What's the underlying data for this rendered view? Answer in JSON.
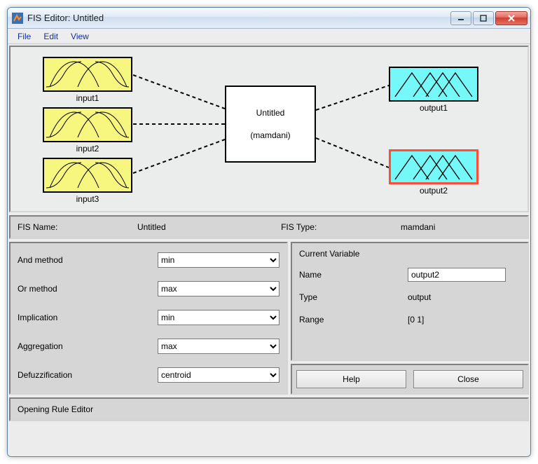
{
  "window": {
    "title": "FIS Editor: Untitled"
  },
  "menu": {
    "file": "File",
    "edit": "Edit",
    "view": "View"
  },
  "canvas": {
    "inputs": [
      "input1",
      "input2",
      "input3"
    ],
    "outputs": [
      "output1",
      "output2"
    ],
    "rule_name": "Untitled",
    "rule_type": "(mamdani)",
    "selected": "output2"
  },
  "info": {
    "fisname_label": "FIS Name:",
    "fisname_value": "Untitled",
    "fistype_label": "FIS Type:",
    "fistype_value": "mamdani"
  },
  "methods": {
    "and": {
      "label": "And method",
      "value": "min"
    },
    "or": {
      "label": "Or method",
      "value": "max"
    },
    "imp": {
      "label": "Implication",
      "value": "min"
    },
    "agg": {
      "label": "Aggregation",
      "value": "max"
    },
    "def": {
      "label": "Defuzzification",
      "value": "centroid"
    }
  },
  "curvar": {
    "heading": "Current Variable",
    "name_label": "Name",
    "name_value": "output2",
    "type_label": "Type",
    "type_value": "output",
    "range_label": "Range",
    "range_value": "[0 1]"
  },
  "buttons": {
    "help": "Help",
    "close": "Close"
  },
  "status": {
    "text": "Opening Rule Editor"
  }
}
